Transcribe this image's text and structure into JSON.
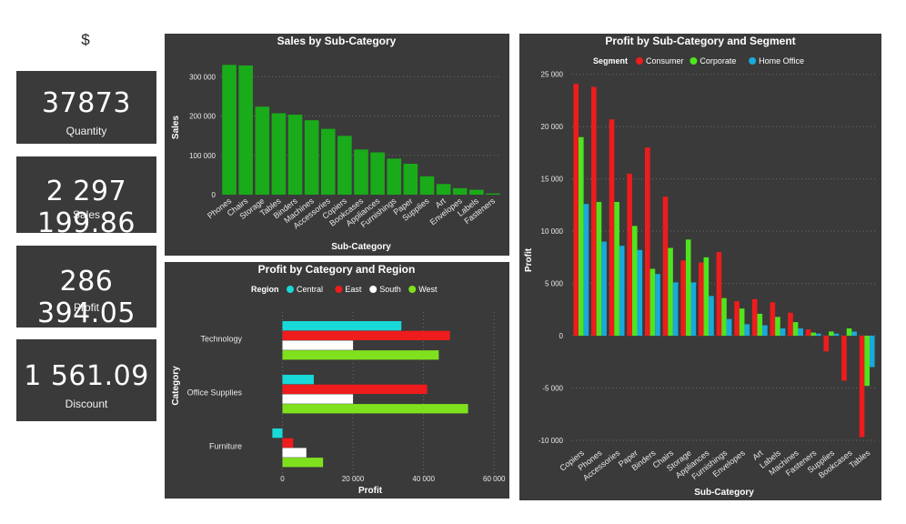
{
  "currency_symbol": "$",
  "kpis": [
    {
      "value": "37873",
      "label": "Quantity"
    },
    {
      "value": "2 297 199.86",
      "label": "Sales"
    },
    {
      "value": "286 394.05",
      "label": "Profit"
    },
    {
      "value": "1 561.09",
      "label": "Discount"
    }
  ],
  "colors": {
    "panel": "#3a3a3a",
    "text": "#ffffff",
    "green": "#1aab1a",
    "cyan": "#19d8d8",
    "red": "#ee1c1c",
    "white": "#ffffff",
    "lime": "#7fe11d",
    "consumer": "#ee1c1c",
    "corporate": "#4fe51d",
    "home_office": "#19a9dd"
  },
  "chart_data": [
    {
      "type": "bar",
      "title": "Sales by Sub-Category",
      "xlabel": "Sub-Category",
      "ylabel": "Sales",
      "categories": [
        "Phones",
        "Chairs",
        "Storage",
        "Tables",
        "Binders",
        "Machines",
        "Accessories",
        "Copiers",
        "Bookcases",
        "Appliances",
        "Furnishings",
        "Paper",
        "Supplies",
        "Art",
        "Envelopes",
        "Labels",
        "Fasteners"
      ],
      "values": [
        330007,
        328449,
        223844,
        206966,
        203413,
        189239,
        167380,
        149528,
        114880,
        107532,
        91705,
        78479,
        46674,
        27119,
        16476,
        12486,
        3024
      ],
      "yticks": [
        "0",
        "100 000",
        "200 000",
        "300 000"
      ],
      "ylim": [
        0,
        340000
      ],
      "grid": true
    },
    {
      "type": "bar",
      "orientation": "horizontal",
      "title": "Profit by Category and Region",
      "xlabel": "Profit",
      "ylabel": "Category",
      "legend_title": "Region",
      "legend_position": "top",
      "categories": [
        "Technology",
        "Office Supplies",
        "Furniture"
      ],
      "series": [
        {
          "name": "Central",
          "values": [
            33697,
            8880,
            -2871
          ]
        },
        {
          "name": "East",
          "values": [
            47462,
            41015,
            3046
          ]
        },
        {
          "name": "South",
          "values": [
            19992,
            19987,
            6771
          ]
        },
        {
          "name": "West",
          "values": [
            44304,
            52610,
            11505
          ]
        }
      ],
      "xticks": [
        "0",
        "20 000",
        "40 000",
        "60 000"
      ],
      "xlim": [
        -4000,
        62000
      ],
      "grid": true
    },
    {
      "type": "bar",
      "title": "Profit by Sub-Category and Segment",
      "xlabel": "Sub-Category",
      "ylabel": "Profit",
      "legend_title": "Segment",
      "legend_position": "top",
      "categories": [
        "Copiers",
        "Phones",
        "Accessories",
        "Paper",
        "Binders",
        "Chairs",
        "Storage",
        "Appliances",
        "Furnishings",
        "Envelopes",
        "Art",
        "Labels",
        "Machines",
        "Fasteners",
        "Supplies",
        "Bookcases",
        "Tables"
      ],
      "series": [
        {
          "name": "Consumer",
          "values": [
            24100,
            23800,
            20700,
            15500,
            18000,
            13300,
            7200,
            7000,
            8000,
            3300,
            3500,
            3200,
            2200,
            600,
            -1500,
            -4300,
            -9700
          ]
        },
        {
          "name": "Corporate",
          "values": [
            19000,
            12800,
            12800,
            10500,
            6400,
            8400,
            9200,
            7500,
            3600,
            2600,
            2100,
            1800,
            1300,
            300,
            400,
            700,
            -4800
          ]
        },
        {
          "name": "Home Office",
          "values": [
            12600,
            9000,
            8600,
            8200,
            5900,
            5100,
            5100,
            3800,
            1600,
            1100,
            1000,
            700,
            700,
            200,
            200,
            400,
            -3000
          ]
        }
      ],
      "yticks": [
        "-10 000",
        "-5 000",
        "0",
        "5 000",
        "10 000",
        "15 000",
        "20 000",
        "25 000"
      ],
      "ylim": [
        -10700,
        25500
      ],
      "grid": true
    }
  ]
}
